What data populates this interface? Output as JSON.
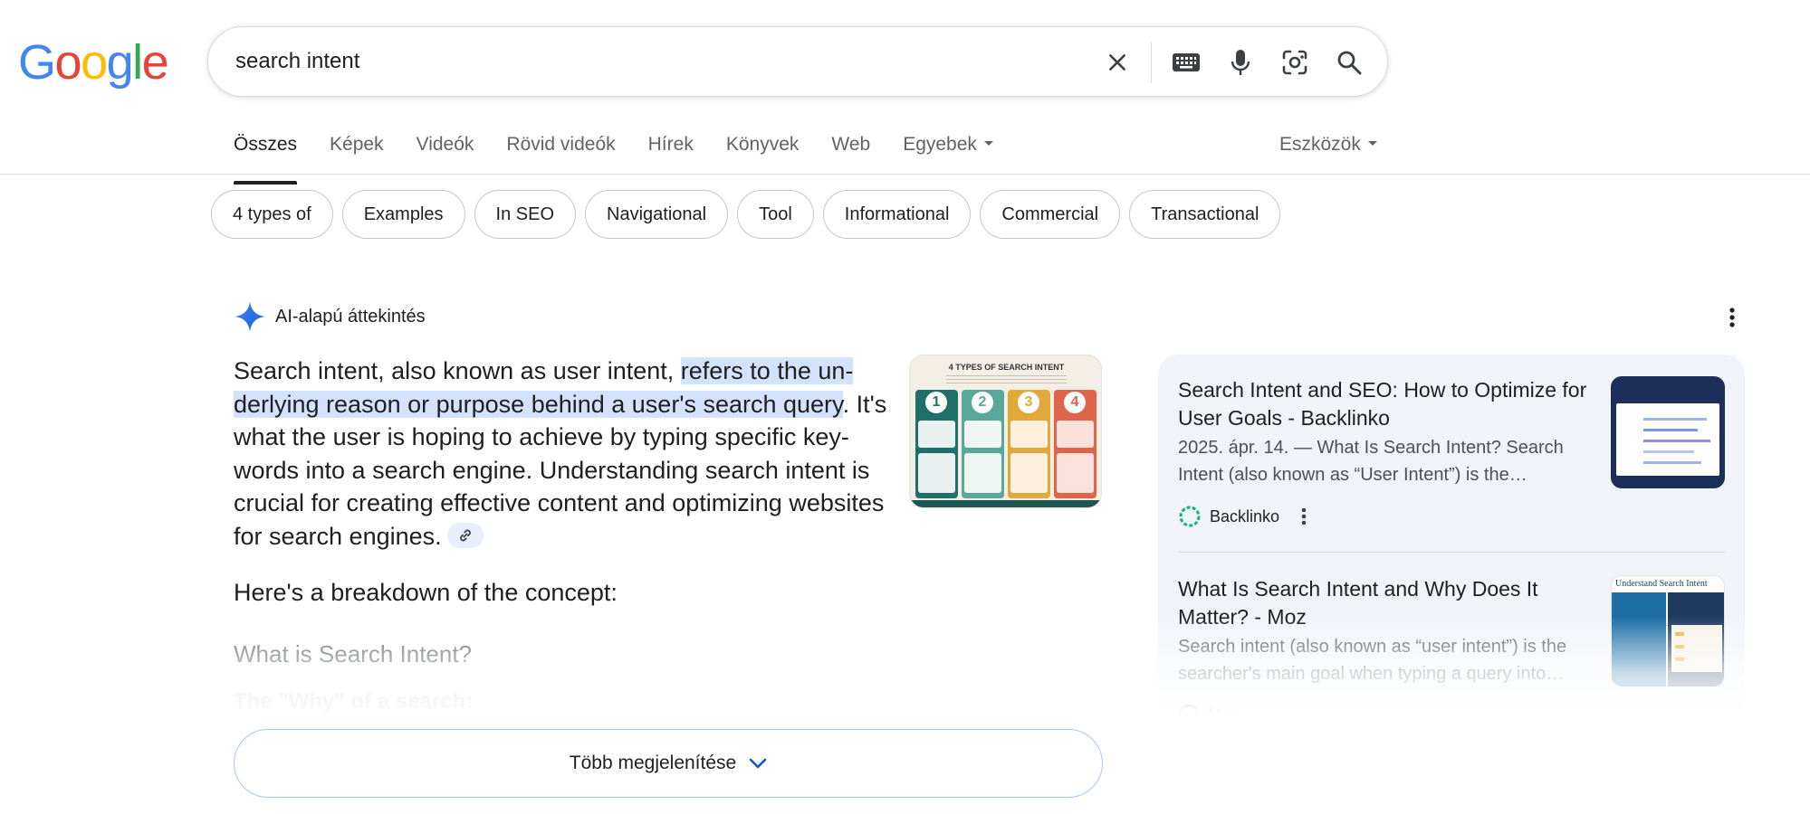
{
  "logo": {
    "letters": [
      "G",
      "o",
      "o",
      "g",
      "l",
      "e"
    ],
    "colors": [
      "#4285F4",
      "#EA4335",
      "#FBBC05",
      "#4285F4",
      "#34A853",
      "#EA4335"
    ]
  },
  "search": {
    "query": "search intent"
  },
  "tabs": [
    {
      "label": "Összes",
      "active": true
    },
    {
      "label": "Képek"
    },
    {
      "label": "Videók"
    },
    {
      "label": "Rövid videók"
    },
    {
      "label": "Hírek"
    },
    {
      "label": "Könyvek"
    },
    {
      "label": "Web"
    },
    {
      "label": "Egyebek"
    }
  ],
  "tools_label": "Eszközök",
  "chips": [
    "4 types of",
    "Examples",
    "In SEO",
    "Navigational",
    "Tool",
    "Informational",
    "Commercial",
    "Transactional"
  ],
  "ai": {
    "title": "AI-alapú áttekintés",
    "text_before": "Search intent, also known as user intent, ",
    "text_highlight": "refers to the un­derlying reason or purpose behind a user's search query",
    "text_after": ". It's what the user is hoping to achieve by typing specific key­words into a search engine. Understanding search intent is crucial for creating effective content and optimizing websites for search engines.",
    "breakdown": "Here's a breakdown of the concept:",
    "heading": "What is Search Intent?",
    "subheading": "The \"Why\" of a search:",
    "show_more": "Több megjelenítése",
    "thumb": {
      "title": "4 TYPES OF SEARCH INTENT",
      "numbers": [
        "1",
        "2",
        "3",
        "4"
      ],
      "colors": [
        "#1f6f6b",
        "#5aa89a",
        "#e2a83a",
        "#e0644a"
      ]
    }
  },
  "sources": [
    {
      "title": "Search Intent and SEO: How to Optimize for User Goals - Backlinko",
      "snippet": "2025. ápr. 14. — What Is Search Intent? Search Intent (also known as “User Intent”) is the…",
      "site": "Backlinko"
    },
    {
      "title": "What Is Search Intent and Why Does It Matter? - Moz",
      "snippet": "Search intent (also known as “user intent”) is the searcher's main goal when typing a query into…",
      "site": "Moz",
      "thumb_heading": "Understand Search Intent"
    }
  ]
}
